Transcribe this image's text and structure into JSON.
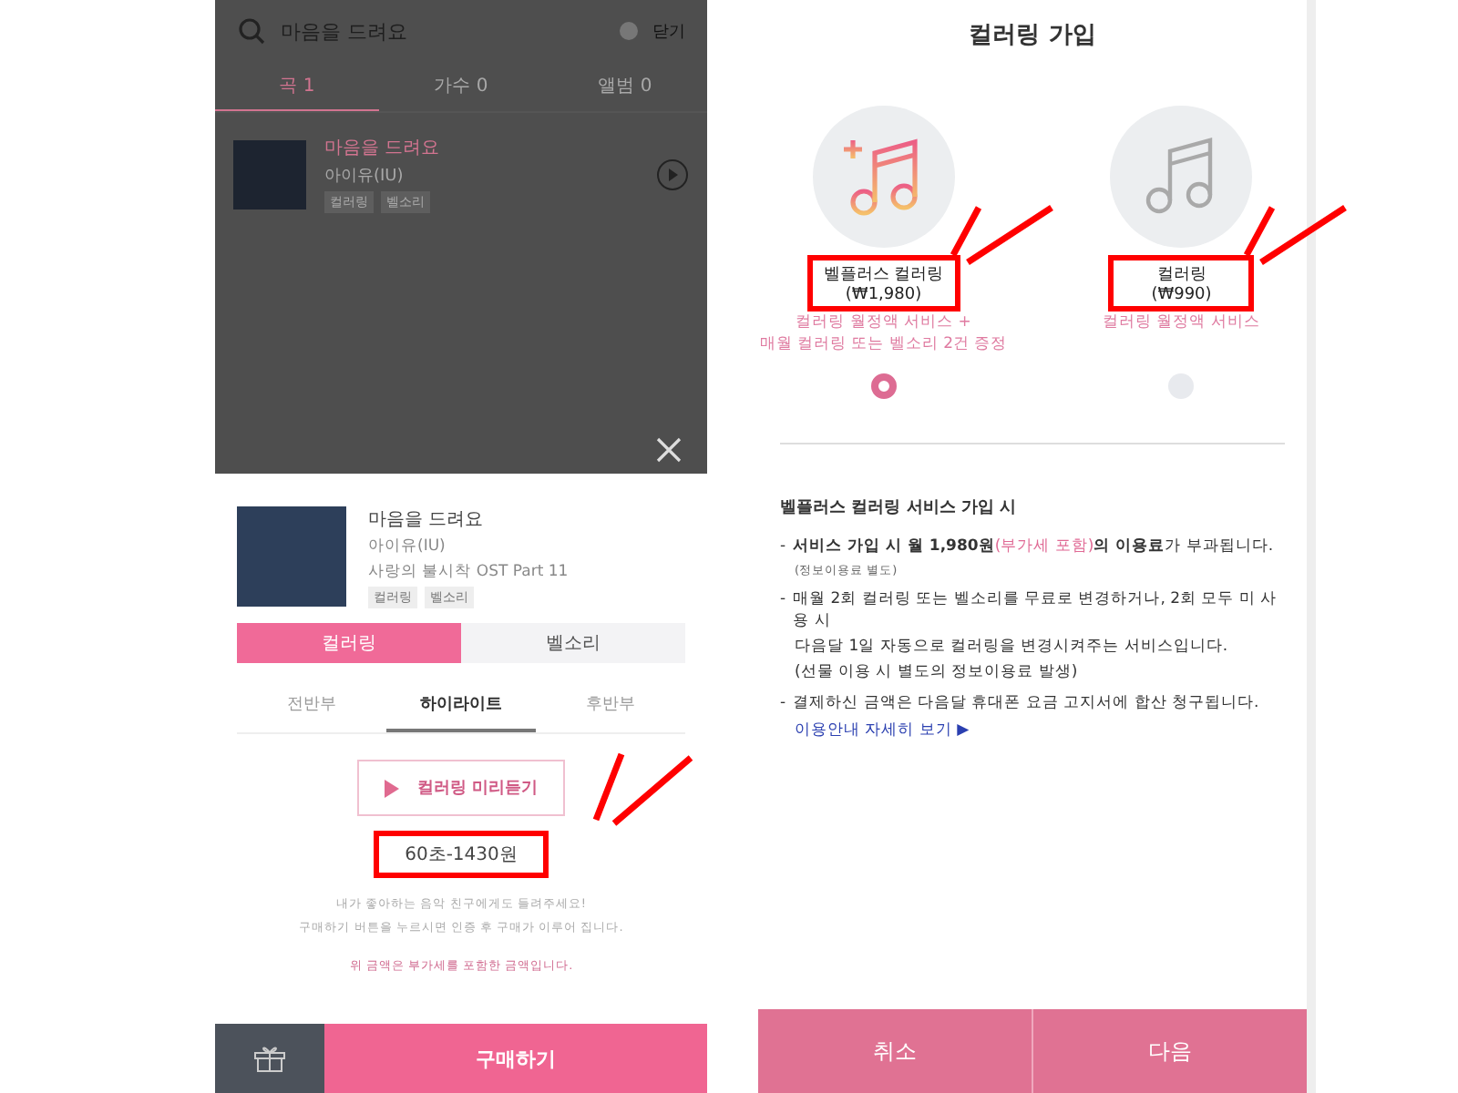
{
  "search_screen": {
    "query": "마음을 드려요",
    "close_label": "닫기",
    "tabs": [
      {
        "label": "곡 1",
        "selected": true
      },
      {
        "label": "가수 0",
        "selected": false
      },
      {
        "label": "앨범 0",
        "selected": false
      }
    ],
    "results": [
      {
        "title": "마음을 드려요",
        "artist": "아이유(IU)",
        "tags": [
          "컬러링",
          "벨소리"
        ]
      }
    ]
  },
  "purchase_sheet": {
    "song": {
      "title": "마음을 드려요",
      "artist": "아이유(IU)",
      "album": "사랑의 불시착 OST Part 11",
      "tags": [
        "컬러링",
        "벨소리"
      ]
    },
    "type_tabs": [
      {
        "label": "컬러링",
        "selected": true
      },
      {
        "label": "벨소리",
        "selected": false
      }
    ],
    "section_tabs": [
      {
        "label": "전반부",
        "selected": false
      },
      {
        "label": "하이라이트",
        "selected": true
      },
      {
        "label": "후반부",
        "selected": false
      }
    ],
    "preview_button": "컬러링 미리듣기",
    "price": {
      "text": "60초-1430원",
      "highlighted": true
    },
    "notes": [
      "내가 좋아하는 음악 친구에게도 들려주세요!",
      "구매하기 버튼을 누르시면 인증 후 구매가 이루어 집니다."
    ],
    "vat_note": "위 금액은 부가세를 포함한 금액입니다.",
    "buy_button": "구매하기"
  },
  "join_screen": {
    "title": "컬러링 가입",
    "plans": [
      {
        "kind": "plus",
        "name": "벨플러스 컬러링",
        "price": "(₩1,980)",
        "description": [
          "컬러링 월정액 서비스 +",
          "매월 컬러링 또는 벨소리 2건 증정"
        ],
        "selected": true,
        "highlighted": true
      },
      {
        "kind": "basic",
        "name": "컬러링",
        "price": "(₩990)",
        "description": [
          "컬러링 월정액 서비스"
        ],
        "selected": false,
        "highlighted": true
      }
    ],
    "info": {
      "heading": "벨플러스 컬러링 서비스 가입 시",
      "items": [
        {
          "bullet": "-",
          "segments": [
            {
              "kind": "bold",
              "text": "서비스 가입 시 월 1,980원"
            },
            {
              "kind": "accent",
              "text": "(부가세 포함)"
            },
            {
              "kind": "bold",
              "text": "의 이용료"
            },
            {
              "kind": "plain",
              "text": "가 부과됩니다."
            }
          ],
          "subnotes": [
            {
              "kind": "small",
              "text": "(정보이용료 별도)"
            }
          ]
        },
        {
          "bullet": "-",
          "segments": [
            {
              "kind": "plain",
              "text": "매월 2회 컬러링 또는 벨소리를 무료로 변경하거나, 2회 모두 미 사용 시"
            }
          ],
          "subnotes": [
            {
              "kind": "normal",
              "text": "다음달 1일 자동으로 컬러링을 변경시켜주는 서비스입니다."
            },
            {
              "kind": "normal",
              "text": "(선물 이용 시 별도의 정보이용료 발생)"
            }
          ]
        },
        {
          "bullet": "-",
          "segments": [
            {
              "kind": "plain",
              "text": "결제하신 금액은 다음달 휴대폰 요금 고지서에 합산 청구됩니다."
            }
          ],
          "subnotes": [
            {
              "kind": "link",
              "text": "이용안내 자세히 보기 ▶"
            }
          ]
        }
      ]
    },
    "buttons": [
      "취소",
      "다음"
    ]
  }
}
